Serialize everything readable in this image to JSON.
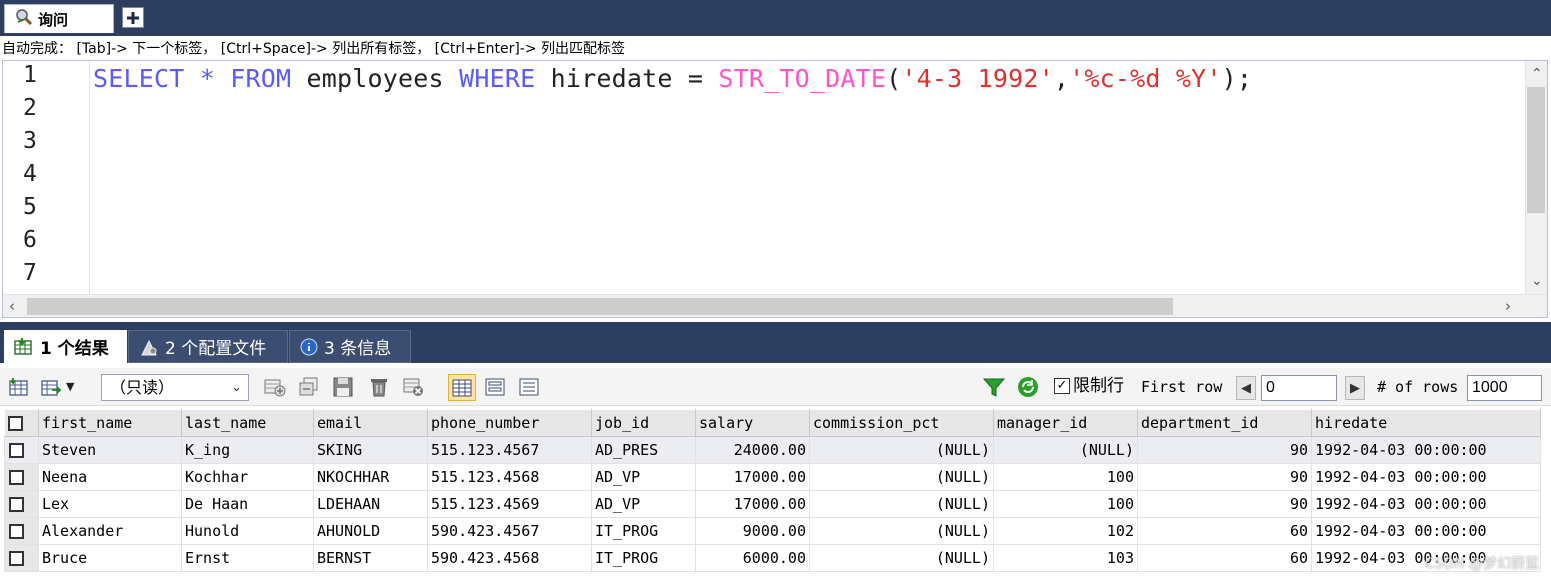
{
  "window": {
    "query_tab_label": "询问",
    "new_tab_symbol": "+"
  },
  "hint": {
    "text": "自动完成： [Tab]-> 下一个标签， [Ctrl+Space]-> 列出所有标签， [Ctrl+Enter]-> 列出匹配标签"
  },
  "editor": {
    "line_numbers": [
      "1",
      "2",
      "3",
      "4",
      "5",
      "6",
      "7"
    ],
    "sql": {
      "kw_select": "SELECT",
      "star": " * ",
      "kw_from": "FROM",
      "table": " employees ",
      "kw_where": "WHERE",
      "cond": " hiredate = ",
      "fn_name": "STR_TO_DATE",
      "paren_open": "(",
      "arg1": "'4-3 1992'",
      "comma": ",",
      "arg2": "'%c-%d %Y'",
      "paren_close": ");"
    }
  },
  "result_tabs": [
    {
      "label": "1 个结果",
      "active": true
    },
    {
      "label": "2 个配置文件",
      "active": false
    },
    {
      "label": "3 条信息",
      "active": false
    }
  ],
  "toolbar": {
    "mode": "（只读）",
    "limit_label": "限制行",
    "limit_checked": true,
    "first_row_label": "First row",
    "first_row_value": "0",
    "rows_label": "# of rows",
    "rows_value": "1000"
  },
  "grid": {
    "columns": [
      "first_name",
      "last_name",
      "email",
      "phone_number",
      "job_id",
      "salary",
      "commission_pct",
      "manager_id",
      "department_id",
      "hiredate"
    ],
    "rows": [
      [
        "Steven",
        "K_ing",
        "SKING",
        "515.123.4567",
        "AD_PRES",
        "24000.00",
        "(NULL)",
        "(NULL)",
        "90",
        "1992-04-03 00:00:00"
      ],
      [
        "Neena",
        "Kochhar",
        "NKOCHHAR",
        "515.123.4568",
        "AD_VP",
        "17000.00",
        "(NULL)",
        "100",
        "90",
        "1992-04-03 00:00:00"
      ],
      [
        "Lex",
        "De Haan",
        "LDEHAAN",
        "515.123.4569",
        "AD_VP",
        "17000.00",
        "(NULL)",
        "100",
        "90",
        "1992-04-03 00:00:00"
      ],
      [
        "Alexander",
        "Hunold",
        "AHUNOLD",
        "590.423.4567",
        "IT_PROG",
        "9000.00",
        "(NULL)",
        "102",
        "60",
        "1992-04-03 00:00:00"
      ],
      [
        "Bruce",
        "Ernst",
        "BERNST",
        "590.423.4568",
        "IT_PROG",
        "6000.00",
        "(NULL)",
        "103",
        "60",
        "1992-04-03 00:00:00"
      ]
    ]
  },
  "watermark": "CSDN @梦幻蔚蓝",
  "colors": {
    "keyword": "#5a5aff",
    "function": "#ff55c8",
    "string": "#e0312e",
    "chrome": "#2d3e5e"
  }
}
